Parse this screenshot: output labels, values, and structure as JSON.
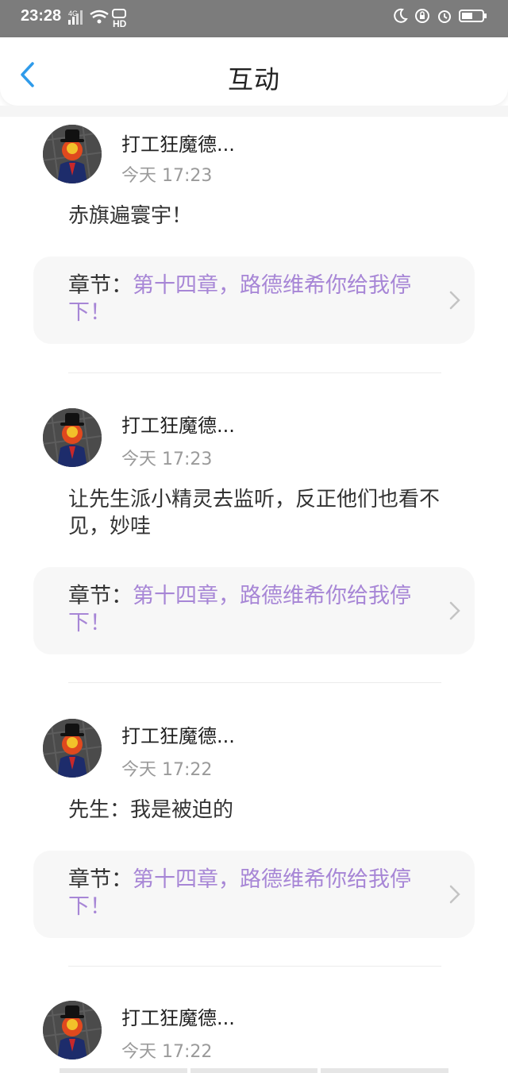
{
  "status_bar": {
    "time": "23:28",
    "network": "4G",
    "hd": "HD"
  },
  "header": {
    "title": "互动"
  },
  "chapter_label": "章节：",
  "posts": [
    {
      "username": "打工狂魔德...",
      "time": "今天 17:23",
      "content": "赤旗遍寰宇！",
      "chapter": "第十四章，路德维希你给我停下！"
    },
    {
      "username": "打工狂魔德...",
      "time": "今天 17:23",
      "content": "让先生派小精灵去监听，反正他们也看不见，妙哇",
      "chapter": "第十四章，路德维希你给我停下！"
    },
    {
      "username": "打工狂魔德...",
      "time": "今天 17:22",
      "content": "先生：我是被迫的",
      "chapter": "第十四章，路德维希你给我停下！"
    },
    {
      "username": "打工狂魔德...",
      "time": "今天 17:22"
    }
  ],
  "colors": {
    "accent": "#2f9bea",
    "chapter_link": "#a786d6",
    "status_bar": "#7c7c7c"
  }
}
